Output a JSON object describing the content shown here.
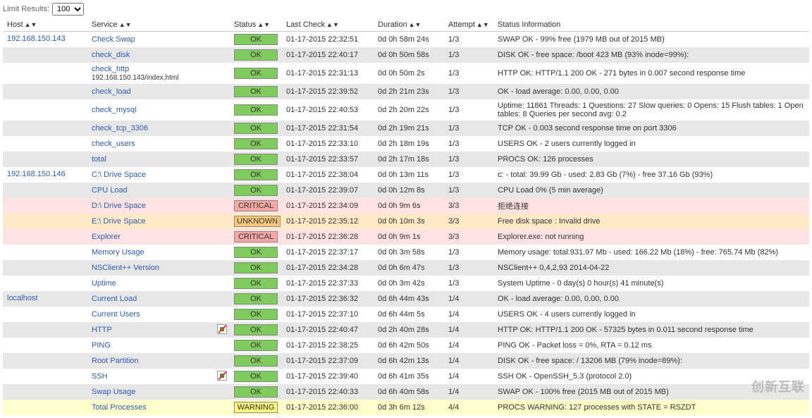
{
  "limit_label": "Limit Results:",
  "limit_value": "100",
  "headers": {
    "host": "Host",
    "service": "Service",
    "status": "Status",
    "last_check": "Last Check",
    "duration": "Duration",
    "attempt": "Attempt",
    "status_info": "Status Information"
  },
  "hosts": [
    {
      "name": "192.168.150.143",
      "services": [
        {
          "service": "Check Swap",
          "status": "OK",
          "last": "01-17-2015 22:32:51",
          "duration": "0d 0h 58m 24s",
          "attempt": "1/3",
          "info": "SWAP OK - 99% free (1979 MB out of 2015 MB)",
          "bg": "even"
        },
        {
          "service": "check_disk",
          "status": "OK",
          "last": "01-17-2015 22:40:17",
          "duration": "0d 0h 50m 58s",
          "attempt": "1/3",
          "info": "DISK OK - free space: /boot 423 MB (93% inode=99%):",
          "bg": "odd"
        },
        {
          "service": "check_http",
          "extra": "192.168.150.143/index.html",
          "status": "OK",
          "last": "01-17-2015 22:31:13",
          "duration": "0d 0h 50m 2s",
          "attempt": "1/3",
          "info": "HTTP OK: HTTP/1.1 200 OK - 271 bytes in 0.007 second response time",
          "bg": "even"
        },
        {
          "service": "check_load",
          "status": "OK",
          "last": "01-17-2015 22:39:52",
          "duration": "0d 2h 21m 23s",
          "attempt": "1/3",
          "info": "OK - load average: 0.00, 0.00, 0.00",
          "bg": "odd"
        },
        {
          "service": "check_mysql",
          "status": "OK",
          "last": "01-17-2015 22:40:53",
          "duration": "0d 2h 20m 22s",
          "attempt": "1/3",
          "info": "Uptime: 11861 Threads: 1 Questions: 27 Slow queries: 0 Opens: 15 Flush tables: 1 Open tables: 8 Queries per second avg: 0.2",
          "bg": "even"
        },
        {
          "service": "check_tcp_3306",
          "status": "OK",
          "last": "01-17-2015 22:31:54",
          "duration": "0d 2h 19m 21s",
          "attempt": "1/3",
          "info": "TCP OK - 0.003 second response time on port 3306",
          "bg": "odd"
        },
        {
          "service": "check_users",
          "status": "OK",
          "last": "01-17-2015 22:33:10",
          "duration": "0d 2h 18m 19s",
          "attempt": "1/3",
          "info": "USERS OK - 2 users currently logged in",
          "bg": "even"
        },
        {
          "service": "total",
          "status": "OK",
          "last": "01-17-2015 22:33:57",
          "duration": "0d 2h 17m 18s",
          "attempt": "1/3",
          "info": "PROCS OK: 126 processes",
          "bg": "odd"
        }
      ]
    },
    {
      "name": "192.168.150.146",
      "services": [
        {
          "service": "C:\\ Drive Space",
          "status": "OK",
          "last": "01-17-2015 22:38:04",
          "duration": "0d 0h 13m 11s",
          "attempt": "1/3",
          "info": "c: - total: 39.99 Gb - used: 2.83 Gb (7%) - free 37.16 Gb (93%)",
          "bg": "even"
        },
        {
          "service": "CPU Load",
          "status": "OK",
          "last": "01-17-2015 22:39:07",
          "duration": "0d 0h 12m 8s",
          "attempt": "1/3",
          "info": "CPU Load 0% (5 min average)",
          "bg": "odd"
        },
        {
          "service": "D:\\ Drive Space",
          "status": "CRITICAL",
          "last": "01-17-2015 22:34:09",
          "duration": "0d 0h 9m 6s",
          "attempt": "3/3",
          "info": "拒绝连接",
          "bg": "crit"
        },
        {
          "service": "E:\\ Drive Space",
          "status": "UNKNOWN",
          "last": "01-17-2015 22:35:12",
          "duration": "0d 0h 10m 3s",
          "attempt": "3/3",
          "info": "Free disk space : Invalid drive",
          "bg": "unk"
        },
        {
          "service": "Explorer",
          "status": "CRITICAL",
          "last": "01-17-2015 22:36:28",
          "duration": "0d 0h 9m 1s",
          "attempt": "3/3",
          "info": "Explorer.exe: not running",
          "bg": "crit"
        },
        {
          "service": "Memory Usage",
          "status": "OK",
          "last": "01-17-2015 22:37:17",
          "duration": "0d 0h 3m 58s",
          "attempt": "1/3",
          "info": "Memory usage: total:931.97 Mb - used: 166.22 Mb (18%) - free: 765.74 Mb (82%)",
          "bg": "even"
        },
        {
          "service": "NSClient++ Version",
          "status": "OK",
          "last": "01-17-2015 22:34:28",
          "duration": "0d 0h 6m 47s",
          "attempt": "1/3",
          "info": "NSClient++ 0,4,2,93 2014-04-22",
          "bg": "odd"
        },
        {
          "service": "Uptime",
          "status": "OK",
          "last": "01-17-2015 22:37:33",
          "duration": "0d 0h 3m 42s",
          "attempt": "1/3",
          "info": "System Uptime - 0 day(s) 0 hour(s) 41 minute(s)",
          "bg": "even"
        }
      ]
    },
    {
      "name": "localhost",
      "services": [
        {
          "service": "Current Load",
          "status": "OK",
          "last": "01-17-2015 22:36:32",
          "duration": "0d 6h 44m 43s",
          "attempt": "1/4",
          "info": "OK - load average: 0.00, 0.00, 0.00",
          "bg": "odd"
        },
        {
          "service": "Current Users",
          "status": "OK",
          "last": "01-17-2015 22:37:10",
          "duration": "0d 6h 44m 5s",
          "attempt": "1/4",
          "info": "USERS OK - 4 users currently logged in",
          "bg": "even"
        },
        {
          "service": "HTTP",
          "notify_off": true,
          "status": "OK",
          "last": "01-17-2015 22:40:47",
          "duration": "0d 2h 40m 28s",
          "attempt": "1/4",
          "info": "HTTP OK: HTTP/1.1 200 OK - 57325 bytes in 0.011 second response time",
          "bg": "odd"
        },
        {
          "service": "PING",
          "status": "OK",
          "last": "01-17-2015 22:38:25",
          "duration": "0d 6h 42m 50s",
          "attempt": "1/4",
          "info": "PING OK - Packet loss = 0%, RTA = 0.12 ms",
          "bg": "even"
        },
        {
          "service": "Root Partition",
          "status": "OK",
          "last": "01-17-2015 22:37:09",
          "duration": "0d 6h 42m 13s",
          "attempt": "1/4",
          "info": "DISK OK - free space: / 13206 MB (79% inode=89%):",
          "bg": "odd"
        },
        {
          "service": "SSH",
          "notify_off": true,
          "status": "OK",
          "last": "01-17-2015 22:39:40",
          "duration": "0d 6h 41m 35s",
          "attempt": "1/4",
          "info": "SSH OK - OpenSSH_5.3 (protocol 2.0)",
          "bg": "even"
        },
        {
          "service": "Swap Usage",
          "status": "OK",
          "last": "01-17-2015 22:40:33",
          "duration": "0d 6h 40m 58s",
          "attempt": "1/4",
          "info": "SWAP OK - 100% free (2015 MB out of 2015 MB)",
          "bg": "odd"
        },
        {
          "service": "Total Processes",
          "status": "WARNING",
          "last": "01-17-2015 22:36:00",
          "duration": "0d 3h 6m 12s",
          "attempt": "4/4",
          "info": "PROCS WARNING: 127 processes with STATE = RSZDT",
          "bg": "warn"
        }
      ]
    }
  ],
  "watermark": "创新互联"
}
